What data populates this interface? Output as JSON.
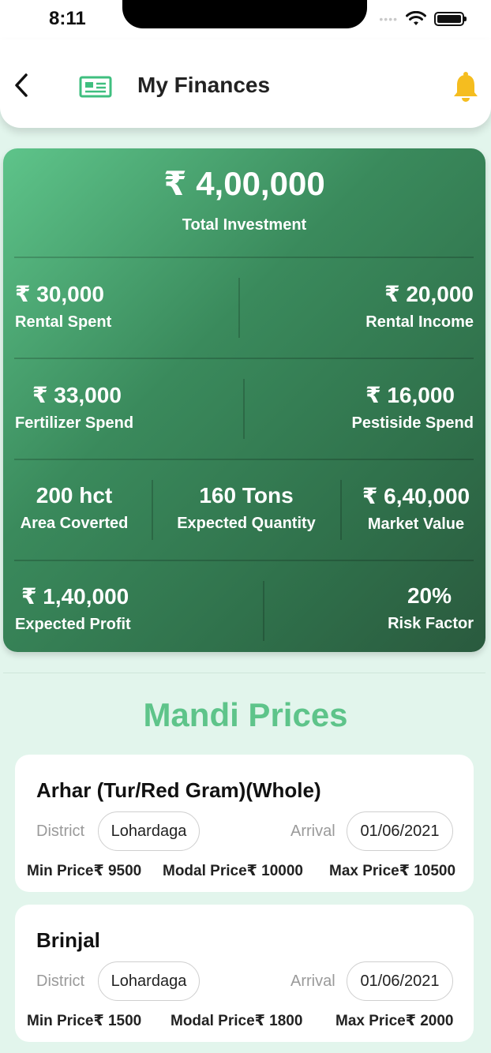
{
  "status_bar": {
    "time": "8:11",
    "signal_dots": "••••"
  },
  "header": {
    "title": "My Finances",
    "icons": [
      "back-chevron-icon",
      "finance-card-icon",
      "bell-icon"
    ],
    "bell_color": "#f5bd1f",
    "icon_accent": "#3fbf7f"
  },
  "summary": {
    "total_investment": {
      "value": "₹ 4,00,000",
      "label": "Total Investment"
    },
    "rental_spent": {
      "value": "₹ 30,000",
      "label": "Rental Spent"
    },
    "rental_income": {
      "value": "₹ 20,000",
      "label": "Rental Income"
    },
    "fertilizer_spend": {
      "value": "₹ 33,000",
      "label": "Fertilizer Spend"
    },
    "pesticide_spend": {
      "value": "₹ 16,000",
      "label": "Pestiside Spend"
    },
    "area_covered": {
      "value": "200 hct",
      "label": "Area Coverted"
    },
    "expected_quantity": {
      "value": "160 Tons",
      "label": "Expected Quantity"
    },
    "market_value": {
      "value": "₹ 6,40,000",
      "label": "Market Value"
    },
    "expected_profit": {
      "value": "₹ 1,40,000",
      "label": "Expected Profit"
    },
    "risk_factor": {
      "value": "20%",
      "label": "Risk Factor"
    }
  },
  "mandi": {
    "title": "Mandi Prices",
    "district_label": "District",
    "arrival_label": "Arrival",
    "items": [
      {
        "crop": "Arhar (Tur/Red Gram)(Whole)",
        "district": "Lohardaga",
        "arrival": "01/06/2021",
        "min_price": "Min Price₹ 9500",
        "modal_price": "Modal Price₹ 10000",
        "max_price": "Max Price₹ 10500"
      },
      {
        "crop": "Brinjal",
        "district": "Lohardaga",
        "arrival": "01/06/2021",
        "min_price": "Min Price₹ 1500",
        "modal_price": "Modal Price₹ 1800",
        "max_price": "Max Price₹ 2000"
      }
    ]
  },
  "colors": {
    "accent_green": "#5ec48a",
    "card_gradient_start": "#5ec48a",
    "card_gradient_end": "#2a5a3e",
    "background": "#e2f5ec"
  }
}
